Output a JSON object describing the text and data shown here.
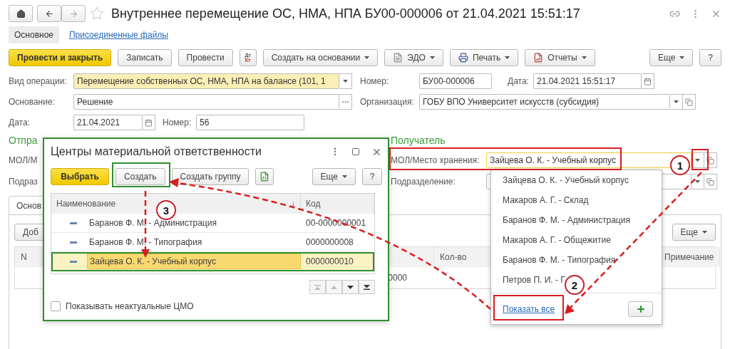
{
  "header": {
    "title": "Внутреннее перемещение ОС, НМА, НПА БУ00-000006 от 21.04.2021 15:51:17"
  },
  "tabs": [
    {
      "label": "Основное",
      "selected": true
    },
    {
      "label": "Присоединенные файлы",
      "selected": false
    }
  ],
  "toolbar": {
    "left": [
      {
        "kind": "primary",
        "label": "Провести и закрыть"
      },
      {
        "kind": "button",
        "label": "Записать"
      },
      {
        "kind": "button",
        "label": "Провести"
      },
      {
        "kind": "dtkt",
        "top": "Дт",
        "bottom": "Кт"
      },
      {
        "kind": "menu",
        "label": "Создать на основании"
      },
      {
        "kind": "edo",
        "label": "ЭДО"
      },
      {
        "kind": "print",
        "label": "Печать"
      },
      {
        "kind": "reports",
        "label": "Отчеты"
      }
    ],
    "right": [
      {
        "kind": "menu",
        "label": "Еще"
      },
      {
        "kind": "button",
        "label": "?"
      }
    ]
  },
  "form_rows": [
    [
      {
        "label": "Вид операции:",
        "value": "Перемещение собственных ОС, НМА, НПА на балансе (101, 1",
        "highlighted": true,
        "buttons": [
          {
            "kind": "dropdown"
          }
        ]
      },
      {
        "label": "Номер:",
        "value": "БУ00-000006",
        "highlighted": false
      },
      {
        "label": "Дата:",
        "value": "21.04.2021 15:51:17",
        "highlighted": false,
        "buttons": [
          {
            "kind": "calendar"
          }
        ]
      }
    ],
    [
      {
        "label": "Основание:",
        "value": "Решение",
        "highlighted": false,
        "buttons": [
          {
            "kind": "choose"
          }
        ]
      },
      {
        "label": "Организация:",
        "value": "ГОБУ ВПО Университет искусств (субсидия)",
        "highlighted": false,
        "buttons": [
          {
            "kind": "dropdown"
          },
          {
            "kind": "open"
          }
        ]
      }
    ],
    [
      {
        "label": "Дата:",
        "value": "21.04.2021",
        "highlighted": false,
        "buttons": [
          {
            "kind": "calendar"
          }
        ]
      },
      {
        "label": "Номер:",
        "value": "56",
        "highlighted": false
      }
    ]
  ],
  "sender": {
    "title": "Отпра",
    "labels": [
      "МОЛ/М",
      "Подраз"
    ]
  },
  "recipient": {
    "title": "Получатель",
    "fields": [
      {
        "label": "МОЛ/Место хранения:",
        "value": "Зайцева О. К. - Учебный корпус",
        "focused": true,
        "buttons": [
          {
            "kind": "dropdown"
          },
          {
            "kind": "open"
          }
        ]
      },
      {
        "label": "Подразделение:",
        "focused": false,
        "buttons": [
          {
            "kind": "dropdown"
          },
          {
            "kind": "open"
          }
        ]
      }
    ]
  },
  "lower_tabs": [
    {
      "label": "Основ",
      "selected": true
    }
  ],
  "table_toolbar": {
    "add": "Доб",
    "more": "Еще"
  },
  "goods_table": {
    "columns": [
      "N",
      "Кол-во",
      "Примечание"
    ],
    "rows": [
      {
        "column_3": "0000"
      }
    ]
  },
  "dialog": {
    "title": "Центры материальной ответственности",
    "buttons": [
      {
        "kind": "primary",
        "label": "Выбрать"
      },
      {
        "kind": "button",
        "label": "Создать"
      },
      {
        "kind": "button",
        "label": "Создать группу"
      },
      {
        "kind": "icon"
      }
    ],
    "more": "Еще",
    "help": "?",
    "columns": [
      "Наименование",
      "Код"
    ],
    "sort": "↓",
    "rows": [
      {
        "name": "Баранов Ф. М. - Администрация",
        "code": "00-0000000001",
        "selected": false
      },
      {
        "name": "Баранов Ф. М. - Типография",
        "code": "0000000008",
        "selected": false
      },
      {
        "name": "Зайцева О. К. - Учебный корпус",
        "code": "0000000010",
        "selected": true
      }
    ],
    "show_inactive": {
      "label": "Показывать неактуальные ЦМО",
      "checked": false
    }
  },
  "dropdown": {
    "items": [
      "Зайцева О. К. - Учебный корпус",
      "Макаров А. Г. - Склад",
      "Баранов Ф. М. - Администрация",
      "Макаров А. Г. - Общежитие",
      "Баранов Ф. М. - Типография",
      "Петров П. И. - Г"
    ],
    "show_all": "Показать все"
  },
  "annotations": {
    "markers": [
      "1",
      "2",
      "3"
    ]
  }
}
